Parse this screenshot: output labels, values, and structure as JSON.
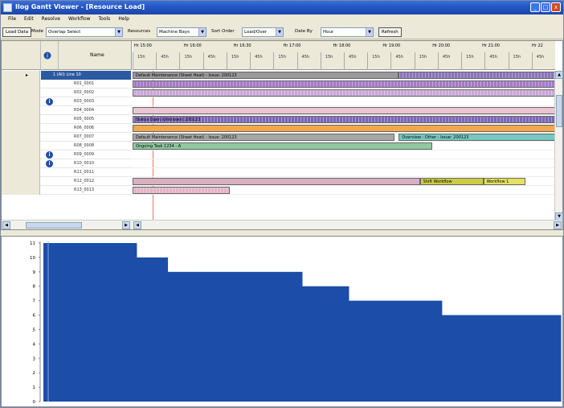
{
  "window": {
    "title": "Ilog Gantt Viewer - [Resource Load]",
    "buttons": [
      "_",
      "□",
      "x"
    ]
  },
  "menu": [
    "File",
    "Edit",
    "Resolve",
    "Workflow",
    "Tools",
    "Help"
  ],
  "toolbar": {
    "load_button": "Load Data",
    "mode_label": "Mode",
    "mode_value": "Overlap Select",
    "resource_label": "Resources",
    "resource_value": "Machine Bays",
    "grid_sort_label": "Sort Order",
    "grid_sort_value": "Load/Over",
    "date_label": "Date By",
    "date_value": "Hour",
    "refresh_button": "Refresh"
  },
  "gantt": {
    "header": {
      "name_col": "Name"
    },
    "time_major": [
      "Hr 15:00",
      "Hr 16:00",
      "Hr 16:30",
      "Hr 17:00",
      "Hr 18:00",
      "Hr 19:00",
      "Hr 20:00",
      "Hr 21:00",
      "Hr 22"
    ],
    "time_minor": [
      "15h",
      "45h",
      "15h",
      "45h",
      "15h",
      "45h",
      "15h",
      "45h",
      "15h",
      "45h",
      "15h",
      "45h",
      "15h",
      "45h",
      "15h",
      "45h",
      "15h",
      "45h"
    ],
    "rows": [
      {
        "name": "1 (All) Line 10",
        "selected": true,
        "info": false
      },
      {
        "name": "R01_0001",
        "selected": false,
        "info": false
      },
      {
        "name": "R02_0002",
        "selected": false,
        "info": false
      },
      {
        "name": "R03_0003",
        "selected": false,
        "info": true
      },
      {
        "name": "R04_0004",
        "selected": false,
        "info": false
      },
      {
        "name": "R05_0005",
        "selected": false,
        "info": false
      },
      {
        "name": "R06_0006",
        "selected": false,
        "info": false
      },
      {
        "name": "R07_0007",
        "selected": false,
        "info": false
      },
      {
        "name": "R08_0008",
        "selected": false,
        "info": false
      },
      {
        "name": "R09_0009",
        "selected": false,
        "info": true
      },
      {
        "name": "R10_0010",
        "selected": false,
        "info": true
      },
      {
        "name": "R11_0011",
        "selected": false,
        "info": false
      },
      {
        "name": "R12_0012",
        "selected": false,
        "info": false
      },
      {
        "name": "R13_0013",
        "selected": false,
        "info": false
      }
    ],
    "bars": [
      {
        "row": 0,
        "start": 0.0,
        "end": 0.63,
        "color": "#9a9a9a",
        "label": "Default Maintenance (Sheet Heat) - Issue: 200123",
        "stripe": false
      },
      {
        "row": 0,
        "start": 0.63,
        "end": 1.0,
        "color": "#8a74b8",
        "label": "",
        "stripe": true
      },
      {
        "row": 1,
        "start": 0.0,
        "end": 1.0,
        "color": "#a57ac9",
        "label": "",
        "stripe": true
      },
      {
        "row": 2,
        "start": 0.0,
        "end": 1.0,
        "color": "#c9a8d8",
        "label": "",
        "stripe": true
      },
      {
        "row": 4,
        "start": 0.0,
        "end": 1.0,
        "color": "#e9c6d2",
        "label": "",
        "stripe": false
      },
      {
        "row": 5,
        "start": 0.0,
        "end": 1.0,
        "color": "#7d66b6",
        "label": "Status Open (Unknown) 200123",
        "stripe": true
      },
      {
        "row": 6,
        "start": 0.0,
        "end": 1.0,
        "color": "#f2a84a",
        "label": "",
        "stripe": false
      },
      {
        "row": 7,
        "start": 0.0,
        "end": 0.62,
        "color": "#a8a8a8",
        "label": "Default Maintenance (Sheet Heat) - Issue: 200123",
        "stripe": false
      },
      {
        "row": 7,
        "start": 0.63,
        "end": 1.0,
        "color": "#76c8c0",
        "label": "Overview - Other - Issue: 200123",
        "stripe": false
      },
      {
        "row": 8,
        "start": 0.0,
        "end": 0.71,
        "color": "#8fcaa0",
        "label": "Ongoing Task 1234 - A",
        "stripe": false
      },
      {
        "row": 12,
        "start": 0.0,
        "end": 0.68,
        "color": "#d8b0c0",
        "label": "",
        "stripe": false
      },
      {
        "row": 12,
        "start": 0.68,
        "end": 0.83,
        "color": "#cccc44",
        "label": "Shift Workflow",
        "stripe": false
      },
      {
        "row": 12,
        "start": 0.83,
        "end": 0.93,
        "color": "#e6e060",
        "label": "Workflow 1",
        "stripe": false
      },
      {
        "row": 13,
        "start": 0.0,
        "end": 0.23,
        "color": "#e3b4c4",
        "label": "",
        "stripe": true
      }
    ]
  },
  "load_chart": {
    "color": "#1c4da8",
    "y_ticks": [
      "11",
      "10",
      "9",
      "8",
      "7",
      "6",
      "5",
      "4",
      "3",
      "2",
      "1",
      "0"
    ],
    "steps": [
      {
        "from": 0.0,
        "to": 0.18,
        "value": 11
      },
      {
        "from": 0.18,
        "to": 0.24,
        "value": 10
      },
      {
        "from": 0.24,
        "to": 0.5,
        "value": 9
      },
      {
        "from": 0.5,
        "to": 0.59,
        "value": 8
      },
      {
        "from": 0.59,
        "to": 0.77,
        "value": 7
      },
      {
        "from": 0.77,
        "to": 1.0,
        "value": 6
      }
    ]
  }
}
